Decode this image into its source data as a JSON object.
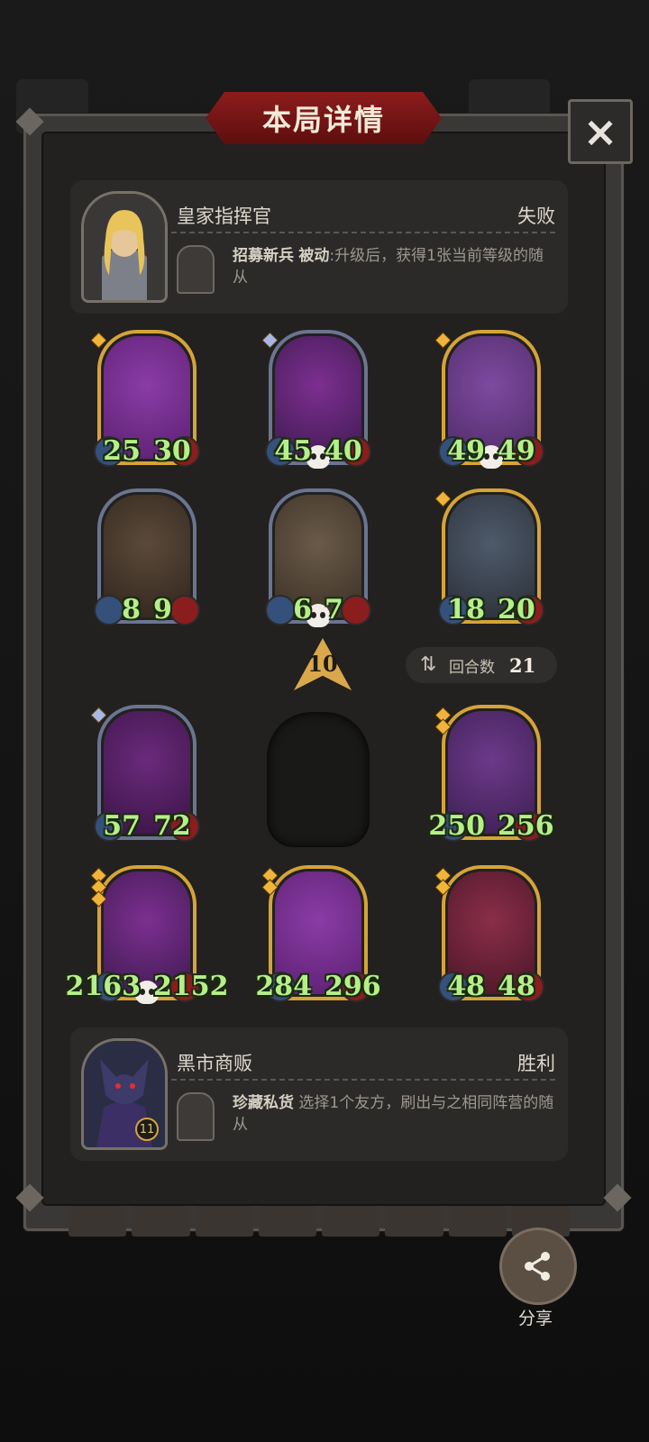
{
  "panel": {
    "title": "本局详情",
    "close_icon": "×"
  },
  "opponent": {
    "name": "皇家指挥官",
    "result": "失败",
    "skill_name": "招募新兵",
    "skill_type": "被动",
    "skill_desc": ":升级后，获得1张当前等级的随从"
  },
  "board_top": [
    {
      "attack": "25",
      "health": "30",
      "stars": 1,
      "star_color": "gold",
      "frame": "gold",
      "skull": false,
      "art": [
        "#8a3ca6",
        "#5b2070"
      ]
    },
    {
      "attack": "45",
      "health": "40",
      "stars": 1,
      "star_color": "blue",
      "frame": "silver",
      "skull": true,
      "art": [
        "#7c2f90",
        "#3e1a50"
      ]
    },
    {
      "attack": "49",
      "health": "49",
      "stars": 1,
      "star_color": "gold",
      "frame": "gold",
      "skull": true,
      "art": [
        "#7e4aa0",
        "#4d2b66"
      ]
    },
    {
      "attack": "8",
      "health": "9",
      "stars": 0,
      "star_color": "gold",
      "frame": "silver",
      "skull": false,
      "art": [
        "#5b4a3a",
        "#2f241c"
      ]
    },
    {
      "attack": "6",
      "health": "7",
      "stars": 0,
      "star_color": "gold",
      "frame": "silver",
      "skull": true,
      "art": [
        "#6a5a48",
        "#3a3026"
      ]
    },
    {
      "attack": "18",
      "health": "20",
      "stars": 1,
      "star_color": "gold",
      "frame": "gold",
      "skull": false,
      "art": [
        "#4e5a6a",
        "#2a2f38"
      ]
    }
  ],
  "level": "10",
  "rounds": {
    "label": "回合数",
    "value": "21"
  },
  "board_bottom": [
    {
      "attack": "57",
      "health": "72",
      "stars": 1,
      "star_color": "blue",
      "frame": "silver",
      "skull": false,
      "art": [
        "#6a2a7c",
        "#3a1444"
      ]
    },
    {
      "attack": "250",
      "health": "256",
      "stars": 2,
      "star_color": "gold",
      "frame": "gold",
      "skull": false,
      "art": [
        "#6c3a8a",
        "#3c1e52"
      ]
    },
    {
      "attack": "2163",
      "health": "2152",
      "stars": 3,
      "star_color": "gold",
      "frame": "gold",
      "skull": true,
      "art": [
        "#7c2f90",
        "#3e1a50"
      ]
    },
    {
      "attack": "284",
      "health": "296",
      "stars": 2,
      "star_color": "gold",
      "frame": "gold",
      "skull": false,
      "art": [
        "#8a3ca6",
        "#5b2070"
      ]
    },
    {
      "attack": "48",
      "health": "48",
      "stars": 2,
      "star_color": "gold",
      "frame": "gold",
      "skull": false,
      "art": [
        "#8a2e4a",
        "#4a1626"
      ]
    }
  ],
  "player": {
    "name": "黑市商贩",
    "result": "胜利",
    "skill_name": "珍藏私货",
    "skill_desc": "选择1个友方，刷出与之相同阵营的随从",
    "skill_level": "11"
  },
  "share": {
    "label": "分享"
  }
}
